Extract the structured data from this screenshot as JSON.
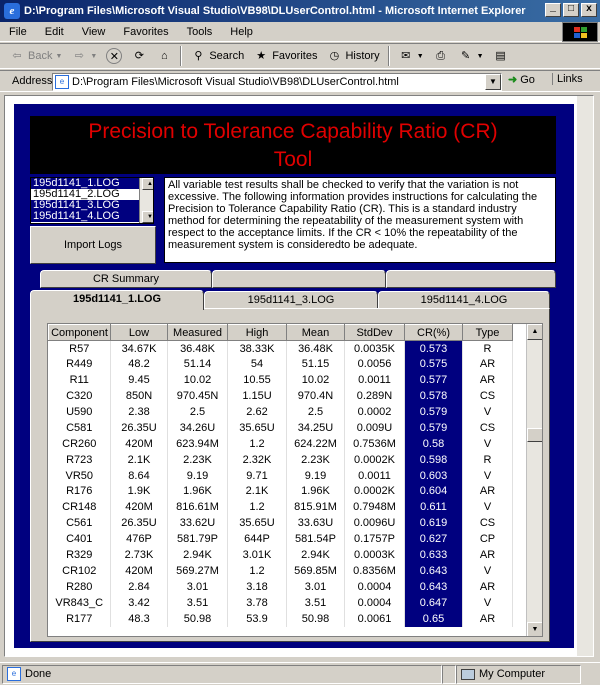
{
  "window": {
    "title": "D:\\Program Files\\Microsoft Visual Studio\\VB98\\DLUserControl.html - Microsoft Internet Explorer"
  },
  "menu": [
    "File",
    "Edit",
    "View",
    "Favorites",
    "Tools",
    "Help"
  ],
  "toolbar": {
    "back": "Back",
    "search": "Search",
    "favorites": "Favorites",
    "history": "History"
  },
  "address": {
    "label": "Address",
    "value": "D:\\Program Files\\Microsoft Visual Studio\\VB98\\DLUserControl.html",
    "go": "Go",
    "links": "Links"
  },
  "page": {
    "title_line1": "Precision to Tolerance Capability Ratio (CR)",
    "title_line2": "Tool",
    "logs": [
      "195d1141_1.LOG",
      "195d1141_2.LOG",
      "195d1141_3.LOG",
      "195d1141_4.LOG"
    ],
    "selected_logs": [
      0,
      2,
      3
    ],
    "import_label": "Import Logs",
    "description": "All variable test results shall be checked to verify that the variation is not excessive.  The following information provides instructions for calculating the Precision to Tolerance Capability Ratio (CR).  This is a standard industry method for determining the repeatability of the measurement system with respect to the acceptance limits.  If the CR < 10% the repeatability of the measurement system is consideredto be adequate.",
    "tabs": {
      "summary": "CR Summary",
      "log1": "195d1141_1.LOG",
      "log3": "195d1141_3.LOG",
      "log4": "195d1141_4.LOG"
    },
    "columns": [
      "Component",
      "Low",
      "Measured",
      "High",
      "Mean",
      "StdDev",
      "CR(%)",
      "Type"
    ],
    "rows": [
      [
        "R57",
        "34.67K",
        "36.48K",
        "38.33K",
        "36.48K",
        "0.0035K",
        "0.573",
        "R"
      ],
      [
        "R449",
        "48.2",
        "51.14",
        "54",
        "51.15",
        "0.0056",
        "0.575",
        "AR"
      ],
      [
        "R11",
        "9.45",
        "10.02",
        "10.55",
        "10.02",
        "0.0011",
        "0.577",
        "AR"
      ],
      [
        "C320",
        "850N",
        "970.45N",
        "1.15U",
        "970.4N",
        "0.289N",
        "0.578",
        "CS"
      ],
      [
        "U590",
        "2.38",
        "2.5",
        "2.62",
        "2.5",
        "0.0002",
        "0.579",
        "V"
      ],
      [
        "C581",
        "26.35U",
        "34.26U",
        "35.65U",
        "34.25U",
        "0.009U",
        "0.579",
        "CS"
      ],
      [
        "CR260",
        "420M",
        "623.94M",
        "1.2",
        "624.22M",
        "0.7536M",
        "0.58",
        "V"
      ],
      [
        "R723",
        "2.1K",
        "2.23K",
        "2.32K",
        "2.23K",
        "0.0002K",
        "0.598",
        "R"
      ],
      [
        "VR50",
        "8.64",
        "9.19",
        "9.71",
        "9.19",
        "0.0011",
        "0.603",
        "V"
      ],
      [
        "R176",
        "1.9K",
        "1.96K",
        "2.1K",
        "1.96K",
        "0.0002K",
        "0.604",
        "AR"
      ],
      [
        "CR148",
        "420M",
        "816.61M",
        "1.2",
        "815.91M",
        "0.7948M",
        "0.611",
        "V"
      ],
      [
        "C561",
        "26.35U",
        "33.62U",
        "35.65U",
        "33.63U",
        "0.0096U",
        "0.619",
        "CS"
      ],
      [
        "C401",
        "476P",
        "581.79P",
        "644P",
        "581.54P",
        "0.1757P",
        "0.627",
        "CP"
      ],
      [
        "R329",
        "2.73K",
        "2.94K",
        "3.01K",
        "2.94K",
        "0.0003K",
        "0.633",
        "AR"
      ],
      [
        "CR102",
        "420M",
        "569.27M",
        "1.2",
        "569.85M",
        "0.8356M",
        "0.643",
        "V"
      ],
      [
        "R280",
        "2.84",
        "3.01",
        "3.18",
        "3.01",
        "0.0004",
        "0.643",
        "AR"
      ],
      [
        "VR843_C",
        "3.42",
        "3.51",
        "3.78",
        "3.51",
        "0.0004",
        "0.647",
        "V"
      ],
      [
        "R177",
        "48.3",
        "50.98",
        "53.9",
        "50.98",
        "0.0061",
        "0.65",
        "AR"
      ]
    ]
  },
  "status": {
    "text": "Done",
    "zone": "My Computer"
  }
}
